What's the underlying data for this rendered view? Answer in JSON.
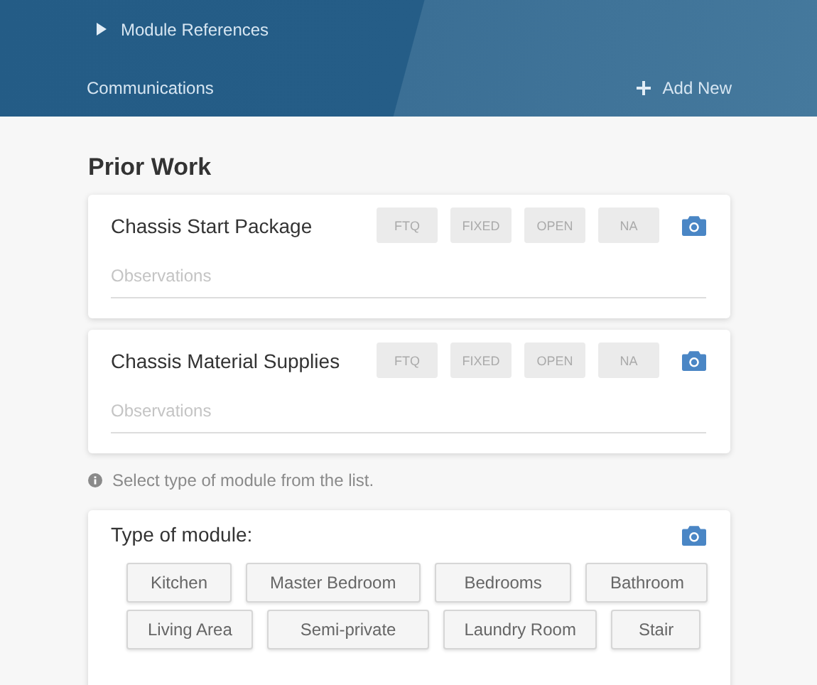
{
  "header": {
    "nav_items": [
      {
        "label": "Module References",
        "kind": "expandable"
      },
      {
        "label": "Communications",
        "kind": "plain"
      }
    ],
    "add_button": {
      "label": "Add New"
    }
  },
  "section_title": "Prior Work",
  "work_items": [
    {
      "title": "Chassis Start Package",
      "observations": {
        "placeholder": "Observations"
      },
      "statuses": [
        {
          "label": "FTQ",
          "selected": false
        },
        {
          "label": "FIXED",
          "selected": false
        },
        {
          "label": "OPEN",
          "selected": false
        },
        {
          "label": "NA",
          "selected": false
        }
      ]
    },
    {
      "title": "Chassis Material Supplies",
      "observations": {
        "placeholder": "Observations"
      },
      "statuses": [
        {
          "label": "FTQ",
          "selected": false
        },
        {
          "label": "FIXED",
          "selected": false
        },
        {
          "label": "OPEN",
          "selected": false
        },
        {
          "label": "NA",
          "selected": false
        }
      ]
    }
  ],
  "hint": "Select type of module from the list.",
  "module_type": {
    "title": "Type of module:",
    "rows": [
      [
        {
          "label": "Kitchen",
          "selected": false
        },
        {
          "label": "Master Bedroom",
          "selected": false
        },
        {
          "label": "Bedrooms",
          "selected": false
        },
        {
          "label": "Bathroom",
          "selected": false
        }
      ],
      [
        {
          "label": "Living Area",
          "selected": false
        },
        {
          "label": "Semi-private",
          "selected": false
        },
        {
          "label": "Laundry Room",
          "selected": false
        },
        {
          "label": "Stair",
          "selected": false
        }
      ]
    ]
  }
}
